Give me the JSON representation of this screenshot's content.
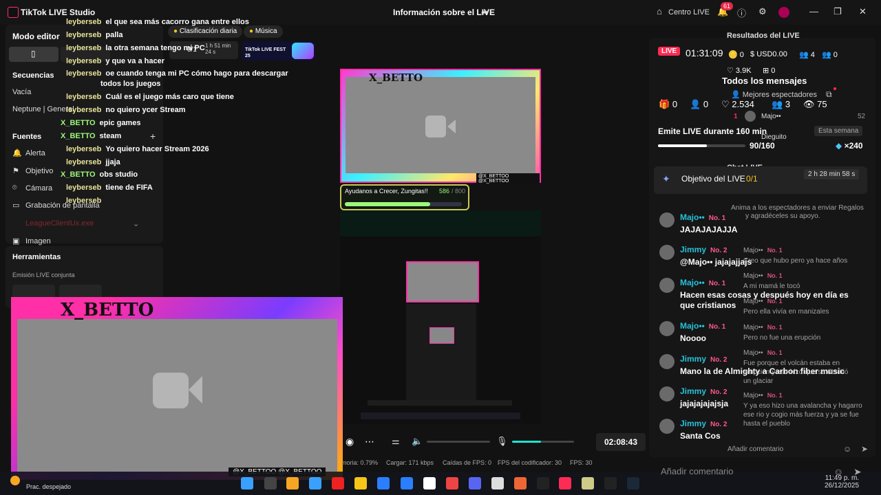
{
  "app": {
    "title": "TikTok LIVE Studio"
  },
  "header": {
    "center_title": "Información sobre el LIVE",
    "centro_live": "Centro LIVE",
    "notif_count": "61"
  },
  "left": {
    "modo_editor": "Modo editor",
    "secuencias": "Secuencias",
    "vacia": "Vacía",
    "neptune": "Neptune | General",
    "fuentes": "Fuentes",
    "sources": [
      "Alerta",
      "Objetivo",
      "Cámara",
      "Grabación de pantalla",
      "LeagueClientUx.exe",
      "Imagen"
    ],
    "herramientas": "Herramientas",
    "emision": "Emisión LIVE conjunta"
  },
  "pills": {
    "clasificacion": "Clasificación diaria",
    "musica": "Música",
    "goal": "0/1",
    "time": "1 h 51 min 24 s",
    "fest": "TikTok LIVE FEST 25"
  },
  "chat_overlay": [
    {
      "user": "leyberseb",
      "text": "el que sea más cacorro gana entre ellos"
    },
    {
      "user": "leyberseb",
      "text": "palla"
    },
    {
      "user": "leyberseb",
      "text": "la otra semana tengo mi PC"
    },
    {
      "user": "leyberseb",
      "text": "y que va a hacer"
    },
    {
      "user": "leyberseb",
      "text": "oe cuando tenga mi PC cómo hago para descargar"
    },
    {
      "user": "",
      "text": "todos los juegos"
    },
    {
      "user": "leyberseb",
      "text": "Cuál es el juego más caro que tiene"
    },
    {
      "user": "leyberseb",
      "text": "no quiero ycer Stream"
    },
    {
      "user": "X_BETTO",
      "text": "epic games",
      "host": true
    },
    {
      "user": "X_BETTO",
      "text": "steam",
      "host": true
    },
    {
      "user": "leyberseb",
      "text": "Yo quiero hacer Stream 2026"
    },
    {
      "user": "leyberseb",
      "text": "jjaja"
    },
    {
      "user": "X_BETTO",
      "text": "obs studio",
      "host": true
    },
    {
      "user": "leyberseb",
      "text": "tiene de FIFA"
    },
    {
      "user": "leyberseb",
      "text": ""
    }
  ],
  "preview": {
    "brand": "X_BETTO",
    "handles": "@X_BETTOO @X_BETTOO",
    "goal_title": "Ayudanos a Crecer, Zungitas!!",
    "goal_value": "586",
    "goal_max": "/ 800",
    "goal_pct": 0.73
  },
  "stats": {
    "memoria": "moria: 0.79%",
    "cargar": "Cargar: 171 kbps",
    "caidas": "Caídas de FPS: 0",
    "fps_cod": "FPS del codificador: 30",
    "fps": "FPS: 30",
    "timer": "02:08:43"
  },
  "right": {
    "live": "LIVE",
    "time": "01:31:09",
    "stats_top": [
      "0",
      "USD0.00",
      "4",
      "0"
    ],
    "likes_top": "3.9K",
    "shares_top": "0",
    "resultados": "Resultados del LIVE",
    "todos": "Todos los mensajes",
    "mejores": "Mejores espectadores",
    "stats_row": [
      "0",
      "0",
      "2.534",
      "3",
      "75"
    ],
    "emite": "Emite LIVE durante 160 min",
    "esta_semana": "Esta semana",
    "emite_progress": "90/160",
    "emite_pct": 0.56,
    "gems": "×240",
    "rank1_name": "Majo••",
    "rank1_score": "52",
    "rank2_name": "Dieguito",
    "chat_live": "Chat LIVE",
    "objetivo": "Objetivo del LIVE",
    "objetivo_val": "0/1",
    "objetivo_time": "2 h 28 min 58 s",
    "anima": "Anima a los espectadores a enviar Regalos",
    "anima2": "y agradéceles su apoyo.",
    "comment_placeholder": "Añadir comentario",
    "ghost_placeholder": "Añadir comentario"
  },
  "messages": [
    {
      "name": "Majo••",
      "badge": "No. 1",
      "text": "JAJAJAJAJJA"
    },
    {
      "name": "Jimmy",
      "badge": "No. 2",
      "text": "@Majo•• jajajajjajs"
    },
    {
      "name": "Majo••",
      "badge": "No. 1",
      "text": "Hacen esas cosas y después hoy en día es"
    },
    {
      "name": "",
      "badge": "",
      "text": "que cristianos"
    },
    {
      "name": "Majo••",
      "badge": "No. 1",
      "text": "Noooo"
    },
    {
      "name": "Jimmy",
      "badge": "No. 2",
      "text": "Mano la de Almighty a Carbon fiber music"
    },
    {
      "name": "Jimmy",
      "badge": "No. 2",
      "text": "jajajajajajsja"
    },
    {
      "name": "Jimmy",
      "badge": "No. 2",
      "text": "Santa Cos"
    }
  ],
  "ghost_msgs": [
    {
      "name": "Majo••",
      "badge": "No. 1",
      "text": "Creo que hubo pero ya hace años"
    },
    {
      "name": "Majo••",
      "badge": "No. 1",
      "text": "A mi mamá le tocó"
    },
    {
      "name": "Majo••",
      "badge": "No. 1",
      "text": "Pero ella vivía en manizales"
    },
    {
      "name": "Majo••",
      "badge": "No. 1",
      "text": "Pero no fue una erupción"
    },
    {
      "name": "Majo••",
      "badge": "No. 1",
      "text": "Fue porque el volcán estaba en"
    },
    {
      "name": "",
      "badge": "",
      "text": "erupción y eso hizo que se derritió"
    },
    {
      "name": "",
      "badge": "",
      "text": "un glaciar"
    },
    {
      "name": "Majo••",
      "badge": "No. 1",
      "text": "Y ya eso hizo una avalancha y hagarro"
    },
    {
      "name": "",
      "badge": "",
      "text": "ese rio y cogio más fuerza y ya se fue"
    },
    {
      "name": "",
      "badge": "",
      "text": "hasta el pueblo"
    }
  ],
  "taskbar": {
    "weather": "Prac. despejado",
    "time": "11:49 p. m.",
    "date": "26/12/2025"
  }
}
